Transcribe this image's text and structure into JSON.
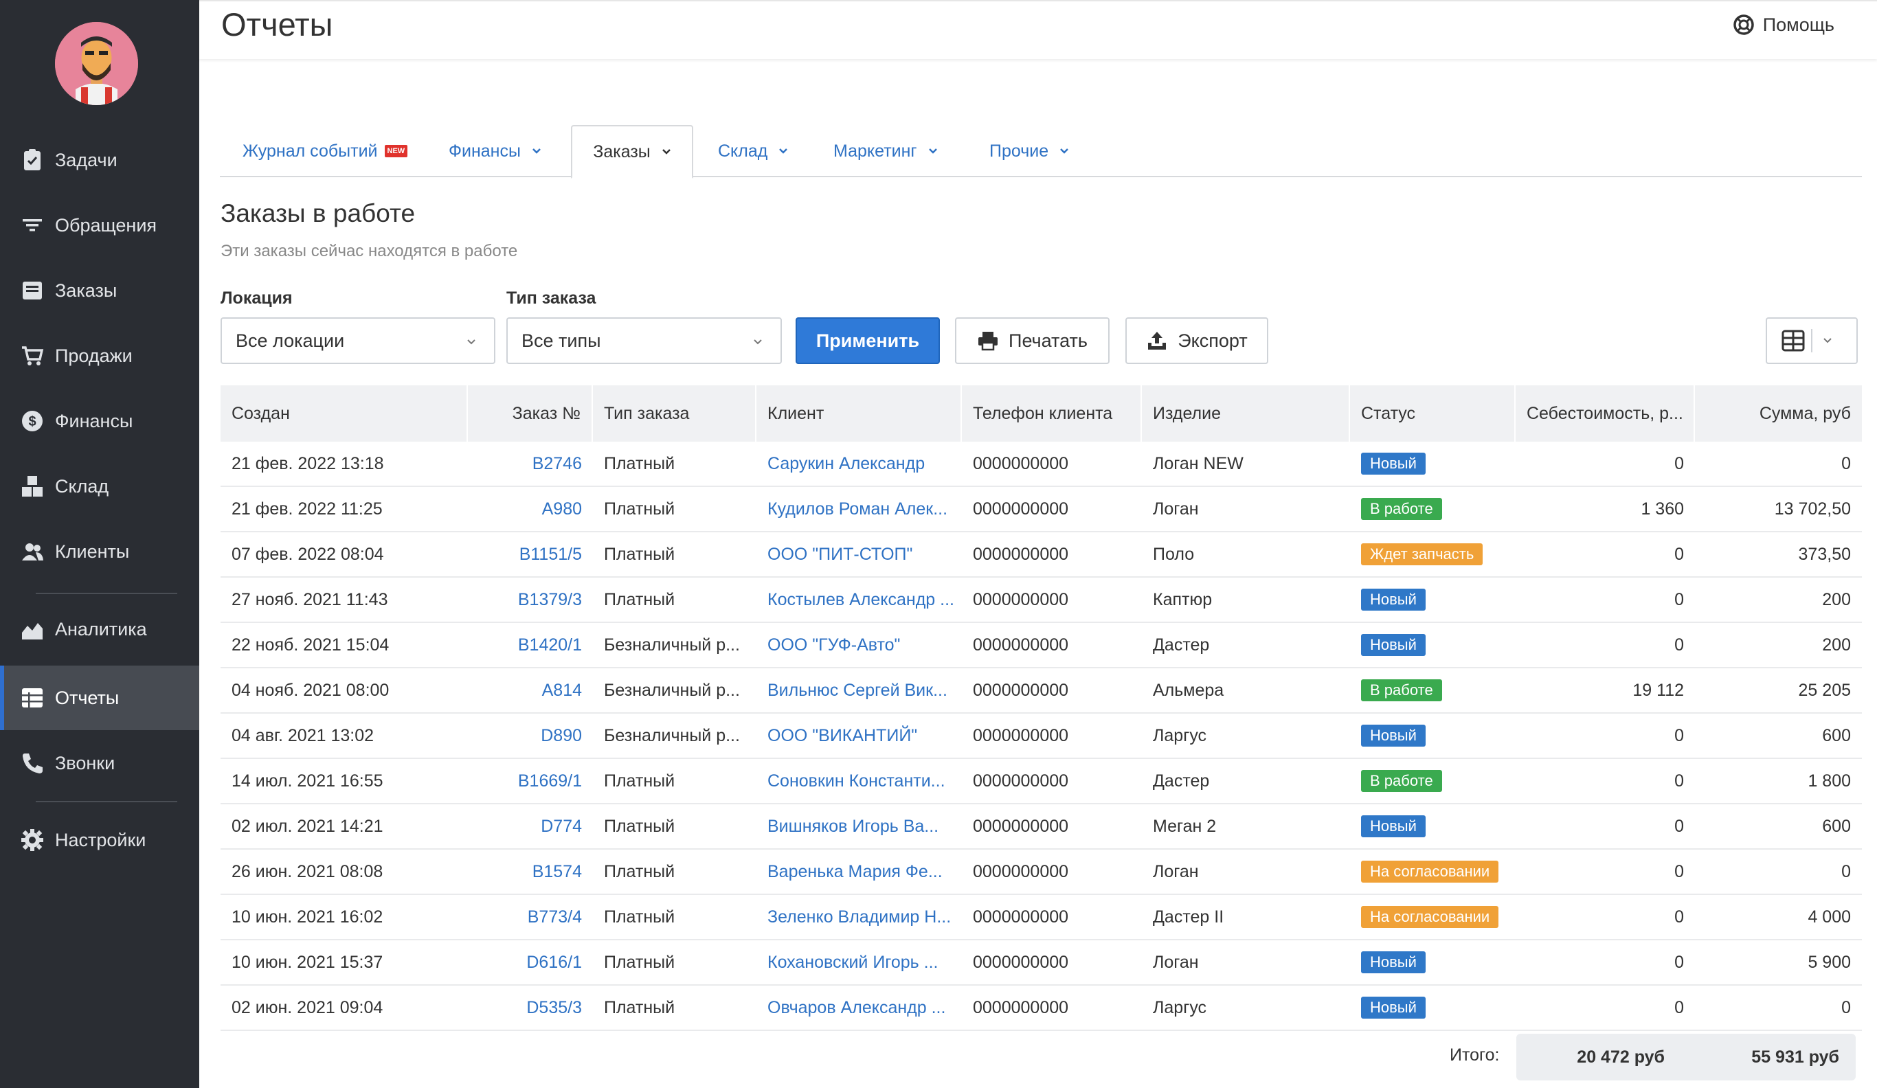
{
  "page_title": "Отчеты",
  "help_label": "Помощь",
  "sidebar": {
    "items": [
      {
        "label": "Задачи",
        "icon": "clipboard-check-icon"
      },
      {
        "label": "Обращения",
        "icon": "filter-icon"
      },
      {
        "label": "Заказы",
        "icon": "inbox-icon"
      },
      {
        "label": "Продажи",
        "icon": "cart-icon"
      },
      {
        "label": "Финансы",
        "icon": "dollar-icon"
      },
      {
        "label": "Склад",
        "icon": "boxes-icon"
      },
      {
        "label": "Клиенты",
        "icon": "users-icon"
      },
      {
        "label": "Аналитика",
        "icon": "area-chart-icon"
      },
      {
        "label": "Отчеты",
        "icon": "reports-icon",
        "active": true
      },
      {
        "label": "Звонки",
        "icon": "phone-icon"
      },
      {
        "label": "Настройки",
        "icon": "gear-icon"
      }
    ]
  },
  "tabs": [
    {
      "label": "Журнал событий",
      "badge": "NEW"
    },
    {
      "label": "Финансы"
    },
    {
      "label": "Заказы",
      "active": true
    },
    {
      "label": "Склад"
    },
    {
      "label": "Маркетинг"
    },
    {
      "label": "Прочие"
    }
  ],
  "section": {
    "title": "Заказы в работе",
    "subtitle": "Эти заказы сейчас находятся в работе"
  },
  "filters": {
    "location_label": "Локация",
    "location_value": "Все локации",
    "type_label": "Тип заказа",
    "type_value": "Все типы"
  },
  "buttons": {
    "apply": "Применить",
    "print": "Печатать",
    "export": "Экспорт"
  },
  "table": {
    "columns": [
      "Создан",
      "Заказ №",
      "Тип заказа",
      "Клиент",
      "Телефон клиента",
      "Изделие",
      "Статус",
      "Себестоимость, р...",
      "Сумма, руб"
    ],
    "rows": [
      {
        "created": "21 фев. 2022 13:18",
        "order": "B2746",
        "type": "Платный",
        "client": "Сарукин Александр",
        "phone": "0000000000",
        "product": "Логан NEW",
        "status": "Новый",
        "cost": "0",
        "sum": "0"
      },
      {
        "created": "21 фев. 2022 11:25",
        "order": "A980",
        "type": "Платный",
        "client": "Кудилов Роман Алек...",
        "phone": "0000000000",
        "product": "Логан",
        "status": "В работе",
        "cost": "1 360",
        "sum": "13 702,50"
      },
      {
        "created": "07 фев. 2022 08:04",
        "order": "B1151/5",
        "type": "Платный",
        "client": "ООО \"ПИТ-СТОП\"",
        "phone": "0000000000",
        "product": "Поло",
        "status": "Ждет запчасть",
        "cost": "0",
        "sum": "373,50"
      },
      {
        "created": "27 нояб. 2021 11:43",
        "order": "B1379/3",
        "type": "Платный",
        "client": "Костылев Александр ...",
        "phone": "0000000000",
        "product": "Каптюр",
        "status": "Новый",
        "cost": "0",
        "sum": "200"
      },
      {
        "created": "22 нояб. 2021 15:04",
        "order": "B1420/1",
        "type": "Безналичный р...",
        "client": "ООО \"ГУФ-Авто\"",
        "phone": "0000000000",
        "product": "Дастер",
        "status": "Новый",
        "cost": "0",
        "sum": "200"
      },
      {
        "created": "04 нояб. 2021 08:00",
        "order": "A814",
        "type": "Безналичный р...",
        "client": "Вильнюс Сергей Вик...",
        "phone": "0000000000",
        "product": "Альмера",
        "status": "В работе",
        "cost": "19 112",
        "sum": "25 205"
      },
      {
        "created": "04 авг. 2021 13:02",
        "order": "D890",
        "type": "Безналичный р...",
        "client": "ООО \"ВИКАНТИЙ\"",
        "phone": "0000000000",
        "product": "Ларгус",
        "status": "Новый",
        "cost": "0",
        "sum": "600"
      },
      {
        "created": "14 июл. 2021 16:55",
        "order": "B1669/1",
        "type": "Платный",
        "client": "Соновкин Константи...",
        "phone": "0000000000",
        "product": "Дастер",
        "status": "В работе",
        "cost": "0",
        "sum": "1 800"
      },
      {
        "created": "02 июл. 2021 14:21",
        "order": "D774",
        "type": "Платный",
        "client": "Вишняков Игорь Ва...",
        "phone": "0000000000",
        "product": "Меган 2",
        "status": "Новый",
        "cost": "0",
        "sum": "600"
      },
      {
        "created": "26 июн. 2021 08:08",
        "order": "B1574",
        "type": "Платный",
        "client": "Варенька Мария Фе...",
        "phone": "0000000000",
        "product": "Логан",
        "status": "На согласовании",
        "cost": "0",
        "sum": "0"
      },
      {
        "created": "10 июн. 2021 16:02",
        "order": "B773/4",
        "type": "Платный",
        "client": "Зеленко Владимир Н...",
        "phone": "0000000000",
        "product": "Дастер II",
        "status": "На согласовании",
        "cost": "0",
        "sum": "4 000"
      },
      {
        "created": "10 июн. 2021 15:37",
        "order": "D616/1",
        "type": "Платный",
        "client": "Кохановский Игорь ...",
        "phone": "0000000000",
        "product": "Логан",
        "status": "Новый",
        "cost": "0",
        "sum": "5 900"
      },
      {
        "created": "02 июн. 2021 09:04",
        "order": "D535/3",
        "type": "Платный",
        "client": "Овчаров Александр ...",
        "phone": "0000000000",
        "product": "Ларгус",
        "status": "Новый",
        "cost": "0",
        "sum": "0"
      }
    ]
  },
  "totals": {
    "label": "Итого:",
    "cost": "20 472 руб",
    "sum": "55 931 руб"
  },
  "status_colors": {
    "Новый": "#2f78c8",
    "В работе": "#3aaa4f",
    "Ждет запчасть": "#f0a137",
    "На согласовании": "#f0a137"
  }
}
